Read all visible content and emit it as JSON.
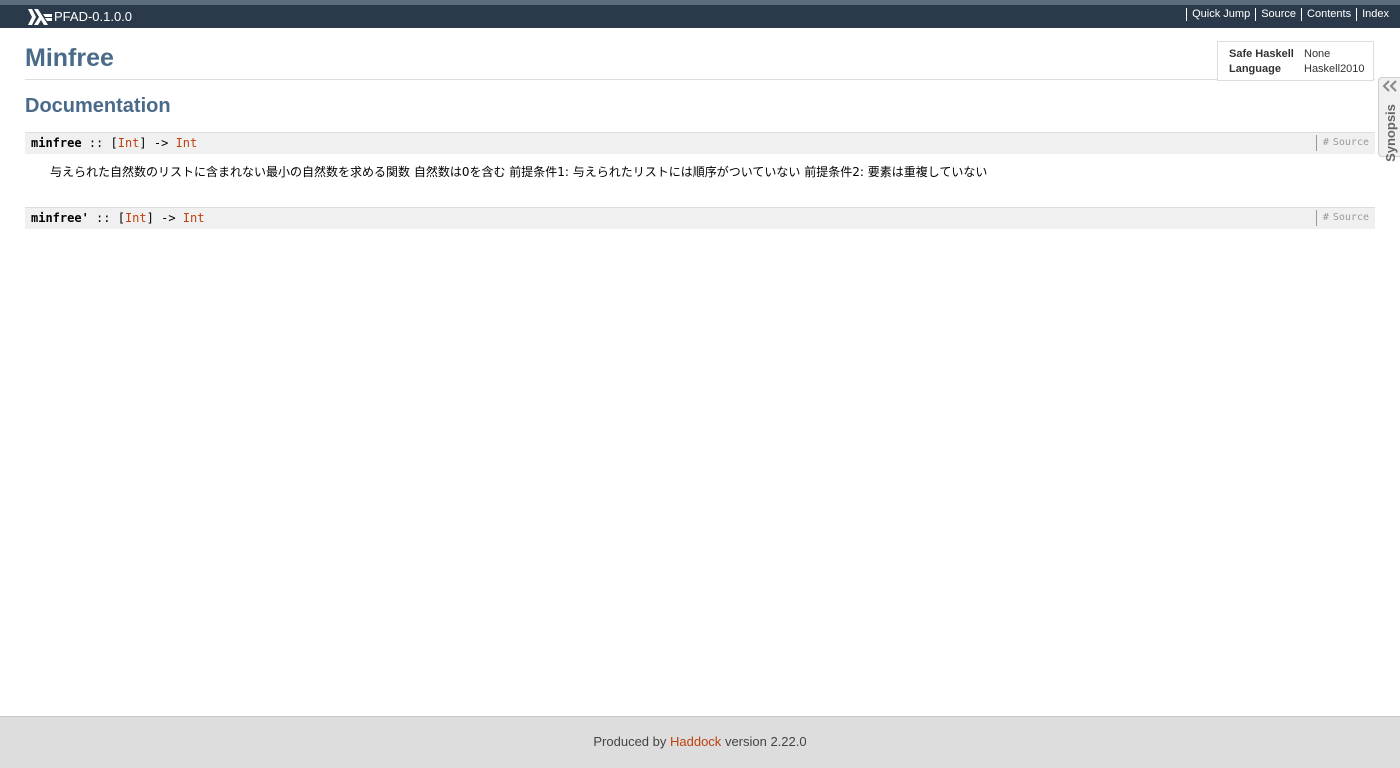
{
  "header": {
    "package": "PFAD-0.1.0.0",
    "links": [
      "Quick Jump",
      "Source",
      "Contents",
      "Index"
    ]
  },
  "module": {
    "title": "Minfree",
    "info": {
      "safe_haskell_label": "Safe Haskell",
      "safe_haskell_value": "None",
      "language_label": "Language",
      "language_value": "Haskell2010"
    },
    "synopsis_label": "Synopsis"
  },
  "documentation": {
    "heading": "Documentation",
    "decls": [
      {
        "name": "minfree",
        "op1": "::",
        "open": "[",
        "type1": "Int",
        "close": "]",
        "arrow": "->",
        "type2": "Int",
        "hash": "#",
        "source": "Source",
        "doc": "与えられた自然数のリストに含まれない最小の自然数を求める関数 自然数は0を含む 前提条件1: 与えられたリストには順序がついていない 前提条件2: 要素は重複していない"
      },
      {
        "name": "minfree'",
        "op1": "::",
        "open": "[",
        "type1": "Int",
        "close": "]",
        "arrow": "->",
        "type2": "Int",
        "hash": "#",
        "source": "Source"
      }
    ]
  },
  "footer": {
    "prefix": "Produced by",
    "link": "Haddock",
    "suffix": "version 2.22.0"
  },
  "colors": {
    "topbar": "#2b3a4a",
    "heading": "#4a6a8a",
    "link": "#c0400e"
  }
}
